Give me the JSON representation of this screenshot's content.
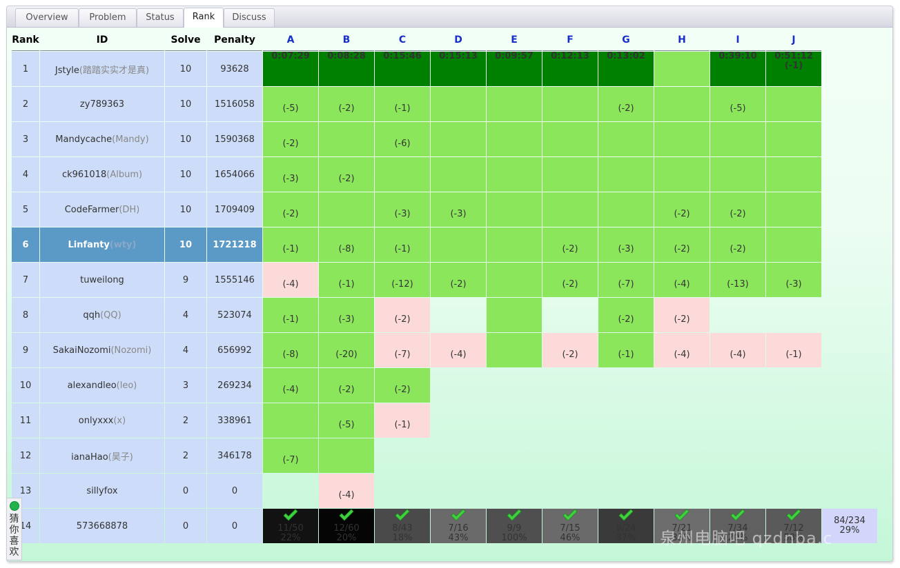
{
  "tabs": [
    {
      "label": "Overview"
    },
    {
      "label": "Problem"
    },
    {
      "label": "Status"
    },
    {
      "label": "Rank"
    },
    {
      "label": "Discuss"
    }
  ],
  "headers": {
    "rank": "Rank",
    "id": "ID",
    "solve": "Solve",
    "penalty": "Penalty"
  },
  "problems": [
    "A",
    "B",
    "C",
    "D",
    "E",
    "F",
    "G",
    "H",
    "I",
    "J"
  ],
  "colors": {
    "first_blood": "#008000",
    "accepted": "#8ce65c",
    "wrong": "#fcdada",
    "me": "#5b9ac7",
    "info": "#cddcf8"
  },
  "rows": [
    {
      "rank": "1",
      "name": "Jstyle",
      "nick": "(踏踏实实才是真)",
      "solve": "10",
      "penalty": "93628",
      "cells": [
        {
          "s": "first",
          "t": "0:07:29"
        },
        {
          "s": "first",
          "t": "0:08:28"
        },
        {
          "s": "first",
          "t": "0:15:46"
        },
        {
          "s": "first",
          "t": "0:15:13"
        },
        {
          "s": "first",
          "t": "0:09:57"
        },
        {
          "s": "first",
          "t": "0:12:13"
        },
        {
          "s": "first",
          "t": "0:13:02"
        },
        {
          "s": "ac",
          "t": ""
        },
        {
          "s": "first",
          "t": "0:39:10"
        },
        {
          "s": "first",
          "t": "0:51:12",
          "t2": "(-1)"
        }
      ]
    },
    {
      "rank": "2",
      "name": "zy789363",
      "nick": "",
      "solve": "10",
      "penalty": "1516058",
      "cells": [
        {
          "s": "ac",
          "t": "(-5)"
        },
        {
          "s": "ac",
          "t": "(-2)"
        },
        {
          "s": "ac",
          "t": "(-1)"
        },
        {
          "s": "ac",
          "t": ""
        },
        {
          "s": "ac",
          "t": ""
        },
        {
          "s": "ac",
          "t": ""
        },
        {
          "s": "ac",
          "t": "(-2)"
        },
        {
          "s": "ac",
          "t": ""
        },
        {
          "s": "ac",
          "t": "(-5)"
        },
        {
          "s": "ac",
          "t": ""
        }
      ]
    },
    {
      "rank": "3",
      "name": "Mandycache",
      "nick": "(Mandy)",
      "solve": "10",
      "penalty": "1590368",
      "cells": [
        {
          "s": "ac",
          "t": "(-2)"
        },
        {
          "s": "ac",
          "t": ""
        },
        {
          "s": "ac",
          "t": "(-6)"
        },
        {
          "s": "ac",
          "t": ""
        },
        {
          "s": "ac",
          "t": ""
        },
        {
          "s": "ac",
          "t": ""
        },
        {
          "s": "ac",
          "t": ""
        },
        {
          "s": "ac",
          "t": ""
        },
        {
          "s": "ac",
          "t": ""
        },
        {
          "s": "ac",
          "t": ""
        }
      ]
    },
    {
      "rank": "4",
      "name": "ck961018",
      "nick": "(Album)",
      "solve": "10",
      "penalty": "1654066",
      "cells": [
        {
          "s": "ac",
          "t": "(-3)"
        },
        {
          "s": "ac",
          "t": "(-2)"
        },
        {
          "s": "ac",
          "t": ""
        },
        {
          "s": "ac",
          "t": ""
        },
        {
          "s": "ac",
          "t": ""
        },
        {
          "s": "ac",
          "t": ""
        },
        {
          "s": "ac",
          "t": ""
        },
        {
          "s": "ac",
          "t": ""
        },
        {
          "s": "ac",
          "t": ""
        },
        {
          "s": "ac",
          "t": ""
        }
      ]
    },
    {
      "rank": "5",
      "name": "CodeFarmer",
      "nick": "(DH)",
      "solve": "10",
      "penalty": "1709409",
      "cells": [
        {
          "s": "ac",
          "t": "(-2)"
        },
        {
          "s": "ac",
          "t": ""
        },
        {
          "s": "ac",
          "t": "(-3)"
        },
        {
          "s": "ac",
          "t": "(-3)"
        },
        {
          "s": "ac",
          "t": ""
        },
        {
          "s": "ac",
          "t": ""
        },
        {
          "s": "ac",
          "t": ""
        },
        {
          "s": "ac",
          "t": "(-2)"
        },
        {
          "s": "ac",
          "t": "(-2)"
        },
        {
          "s": "ac",
          "t": ""
        }
      ]
    },
    {
      "rank": "6",
      "name": "Linfanty",
      "nick": "(wty)",
      "solve": "10",
      "penalty": "1721218",
      "me": true,
      "cells": [
        {
          "s": "ac",
          "t": "(-1)"
        },
        {
          "s": "ac",
          "t": "(-8)"
        },
        {
          "s": "ac",
          "t": "(-1)"
        },
        {
          "s": "ac",
          "t": ""
        },
        {
          "s": "ac",
          "t": ""
        },
        {
          "s": "ac",
          "t": "(-2)"
        },
        {
          "s": "ac",
          "t": "(-3)"
        },
        {
          "s": "ac",
          "t": "(-2)"
        },
        {
          "s": "ac",
          "t": "(-2)"
        },
        {
          "s": "ac",
          "t": ""
        }
      ]
    },
    {
      "rank": "7",
      "name": "tuweilong",
      "nick": "",
      "solve": "9",
      "penalty": "1555146",
      "cells": [
        {
          "s": "wa",
          "t": "(-4)"
        },
        {
          "s": "ac",
          "t": "(-1)"
        },
        {
          "s": "ac",
          "t": "(-12)"
        },
        {
          "s": "ac",
          "t": "(-2)"
        },
        {
          "s": "ac",
          "t": ""
        },
        {
          "s": "ac",
          "t": "(-2)"
        },
        {
          "s": "ac",
          "t": "(-7)"
        },
        {
          "s": "ac",
          "t": "(-4)"
        },
        {
          "s": "ac",
          "t": "(-13)"
        },
        {
          "s": "ac",
          "t": "(-3)"
        }
      ]
    },
    {
      "rank": "8",
      "name": "qqh",
      "nick": "(QQ)",
      "solve": "4",
      "penalty": "523074",
      "cells": [
        {
          "s": "ac",
          "t": "(-1)"
        },
        {
          "s": "ac",
          "t": "(-3)"
        },
        {
          "s": "wa",
          "t": "(-2)"
        },
        {
          "s": "none",
          "t": ""
        },
        {
          "s": "ac",
          "t": ""
        },
        {
          "s": "none",
          "t": ""
        },
        {
          "s": "ac",
          "t": "(-2)"
        },
        {
          "s": "wa",
          "t": "(-2)"
        },
        {
          "s": "none",
          "t": ""
        },
        {
          "s": "none",
          "t": ""
        }
      ]
    },
    {
      "rank": "9",
      "name": "SakaiNozomi",
      "nick": "(Nozomi)",
      "solve": "4",
      "penalty": "656992",
      "cells": [
        {
          "s": "ac",
          "t": "(-8)"
        },
        {
          "s": "ac",
          "t": "(-20)"
        },
        {
          "s": "wa",
          "t": "(-7)"
        },
        {
          "s": "wa",
          "t": "(-4)"
        },
        {
          "s": "ac",
          "t": ""
        },
        {
          "s": "wa",
          "t": "(-2)"
        },
        {
          "s": "ac",
          "t": "(-1)"
        },
        {
          "s": "wa",
          "t": "(-4)"
        },
        {
          "s": "wa",
          "t": "(-4)"
        },
        {
          "s": "wa",
          "t": "(-1)"
        }
      ]
    },
    {
      "rank": "10",
      "name": "alexandleo",
      "nick": "(leo)",
      "solve": "3",
      "penalty": "269234",
      "cells": [
        {
          "s": "ac",
          "t": "(-4)"
        },
        {
          "s": "ac",
          "t": "(-2)"
        },
        {
          "s": "ac",
          "t": "(-2)"
        },
        {
          "s": "none",
          "t": ""
        },
        {
          "s": "none",
          "t": ""
        },
        {
          "s": "none",
          "t": ""
        },
        {
          "s": "none",
          "t": ""
        },
        {
          "s": "none",
          "t": ""
        },
        {
          "s": "none",
          "t": ""
        },
        {
          "s": "none",
          "t": ""
        }
      ]
    },
    {
      "rank": "11",
      "name": "onlyxxx",
      "nick": "(x)",
      "solve": "2",
      "penalty": "338961",
      "cells": [
        {
          "s": "ac",
          "t": ""
        },
        {
          "s": "ac",
          "t": "(-5)"
        },
        {
          "s": "wa",
          "t": "(-1)"
        },
        {
          "s": "none",
          "t": ""
        },
        {
          "s": "none",
          "t": ""
        },
        {
          "s": "none",
          "t": ""
        },
        {
          "s": "none",
          "t": ""
        },
        {
          "s": "none",
          "t": ""
        },
        {
          "s": "none",
          "t": ""
        },
        {
          "s": "none",
          "t": ""
        }
      ]
    },
    {
      "rank": "12",
      "name": "ianaHao",
      "nick": "(昊子)",
      "solve": "2",
      "penalty": "346178",
      "cells": [
        {
          "s": "ac",
          "t": "(-7)"
        },
        {
          "s": "ac",
          "t": ""
        },
        {
          "s": "none",
          "t": ""
        },
        {
          "s": "none",
          "t": ""
        },
        {
          "s": "none",
          "t": ""
        },
        {
          "s": "none",
          "t": ""
        },
        {
          "s": "none",
          "t": ""
        },
        {
          "s": "none",
          "t": ""
        },
        {
          "s": "none",
          "t": ""
        },
        {
          "s": "none",
          "t": ""
        }
      ]
    },
    {
      "rank": "13",
      "name": "sillyfox",
      "nick": "",
      "solve": "0",
      "penalty": "0",
      "cells": [
        {
          "s": "none",
          "t": ""
        },
        {
          "s": "wa",
          "t": "(-4)"
        },
        {
          "s": "none",
          "t": ""
        },
        {
          "s": "none",
          "t": ""
        },
        {
          "s": "none",
          "t": ""
        },
        {
          "s": "none",
          "t": ""
        },
        {
          "s": "none",
          "t": ""
        },
        {
          "s": "none",
          "t": ""
        },
        {
          "s": "none",
          "t": ""
        },
        {
          "s": "none",
          "t": ""
        }
      ]
    },
    {
      "rank": "14",
      "name": "573668878",
      "nick": "",
      "solve": "0",
      "penalty": "0",
      "stats_row": true,
      "cells": []
    }
  ],
  "stats": [
    {
      "ratio": "11/50",
      "pct": "22%",
      "bg": "#121212"
    },
    {
      "ratio": "12/60",
      "pct": "20%",
      "bg": "#050505"
    },
    {
      "ratio": "8/43",
      "pct": "18%",
      "bg": "#4a4a4a"
    },
    {
      "ratio": "7/16",
      "pct": "43%",
      "bg": "#6a6a6a"
    },
    {
      "ratio": "9/9",
      "pct": "100%",
      "bg": "#4f4f4f"
    },
    {
      "ratio": "7/15",
      "pct": "46%",
      "bg": "#6a6a6a"
    },
    {
      "ratio": "9/24",
      "pct": "37%",
      "bg": "#3a3a3a"
    },
    {
      "ratio": "7/21",
      "pct": "33%",
      "bg": "#6d6d6d"
    },
    {
      "ratio": "7/34",
      "pct": "20%",
      "bg": "#606060"
    },
    {
      "ratio": "7/12",
      "pct": "58%",
      "bg": "#5a5a5a"
    }
  ],
  "stats_total": {
    "ratio": "84/234",
    "pct": "29%"
  },
  "sidebar_label": "猜你喜欢",
  "watermark": "泉州电脑吧 qzdnba.c"
}
